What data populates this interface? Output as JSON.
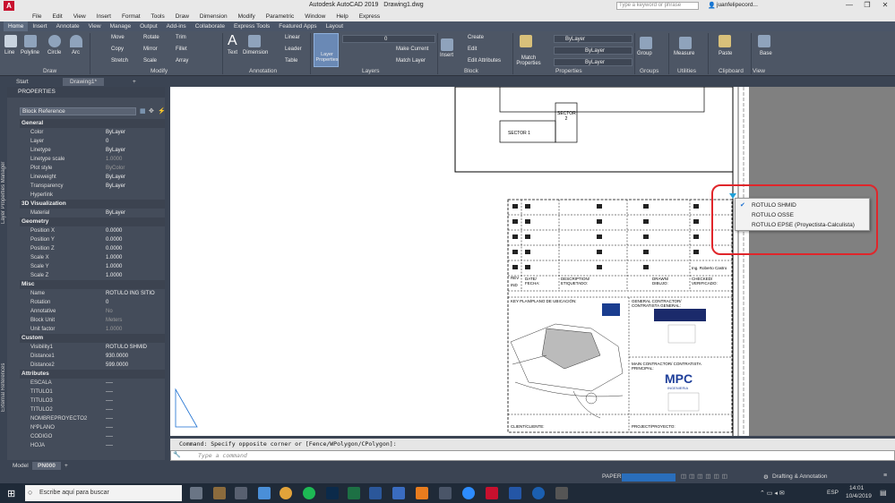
{
  "titlebar": {
    "app": "Autodesk AutoCAD 2019",
    "file": "Drawing1.dwg",
    "search_placeholder": "Type a keyword or phrase",
    "user": "juanfelipecord..."
  },
  "menubar": [
    "File",
    "Edit",
    "View",
    "Insert",
    "Format",
    "Tools",
    "Draw",
    "Dimension",
    "Modify",
    "Parametric",
    "Window",
    "Help",
    "Express"
  ],
  "ribbon_tabs": [
    "Home",
    "Insert",
    "Annotate",
    "View",
    "Manage",
    "Output",
    "Add-ins",
    "Collaborate",
    "Express Tools",
    "Featured Apps",
    "Layout"
  ],
  "ribbon": {
    "draw": [
      "Line",
      "Polyline",
      "Circle",
      "Arc"
    ],
    "modify": [
      "Move",
      "Rotate",
      "Trim",
      "Copy",
      "Mirror",
      "Fillet",
      "Stretch",
      "Scale",
      "Array"
    ],
    "annotation": [
      "Text",
      "Dimension",
      "Linear",
      "Leader",
      "Table"
    ],
    "layers": {
      "btn": "Layer Properties",
      "current": "0",
      "make_current": "Make Current",
      "match_layer": "Match Layer"
    },
    "block": [
      "Insert",
      "Create",
      "Edit",
      "Edit Attributes"
    ],
    "properties": {
      "match": "Match Properties",
      "bylayer1": "ByLayer",
      "bylayer2": "ByLayer",
      "bylayer3": "ByLayer"
    },
    "groups": "Group",
    "utilities": "Measure",
    "clipboard": "Paste",
    "base": "Base",
    "group_labels": [
      "Draw",
      "Modify",
      "Annotation",
      "Layers",
      "Block",
      "Properties",
      "Groups",
      "Utilities",
      "Clipboard",
      "View"
    ]
  },
  "file_tabs": [
    "Start",
    "Drawing1*"
  ],
  "palette": {
    "title": "PROPERTIES",
    "selector": "Block Reference",
    "side_left": "Layer Properties Manager",
    "side_left2": "External References",
    "sections": [
      {
        "name": "General",
        "props": [
          [
            "Color",
            "ByLayer"
          ],
          [
            "Layer",
            "0"
          ],
          [
            "Linetype",
            "ByLayer"
          ],
          [
            "Linetype scale",
            "1.0000"
          ],
          [
            "Plot style",
            "ByColor"
          ],
          [
            "Lineweight",
            "ByLayer"
          ],
          [
            "Transparency",
            "ByLayer"
          ],
          [
            "Hyperlink",
            ""
          ]
        ]
      },
      {
        "name": "3D Visualization",
        "props": [
          [
            "Material",
            "ByLayer"
          ]
        ]
      },
      {
        "name": "Geometry",
        "props": [
          [
            "Position X",
            "0.0000"
          ],
          [
            "Position Y",
            "0.0000"
          ],
          [
            "Position Z",
            "0.0000"
          ],
          [
            "Scale X",
            "1.0000"
          ],
          [
            "Scale Y",
            "1.0000"
          ],
          [
            "Scale Z",
            "1.0000"
          ]
        ]
      },
      {
        "name": "Misc",
        "props": [
          [
            "Name",
            "ROTULO ING SITIO"
          ],
          [
            "Rotation",
            "0"
          ],
          [
            "Annotative",
            "No"
          ],
          [
            "Block Unit",
            "Meters"
          ],
          [
            "Unit factor",
            "1.0000"
          ]
        ]
      },
      {
        "name": "Custom",
        "props": [
          [
            "Visibility1",
            "ROTULO SHMID"
          ],
          [
            "Distance1",
            "930.0000"
          ],
          [
            "Distance2",
            "599.0000"
          ]
        ]
      },
      {
        "name": "Attributes",
        "props": [
          [
            "ESCALA",
            "----"
          ],
          [
            "TITULO1",
            "----"
          ],
          [
            "TITULO3",
            "----"
          ],
          [
            "TITULO2",
            "----"
          ],
          [
            "NOMBREPROYECTO2",
            "----"
          ],
          [
            "NºPLANO",
            "----"
          ],
          [
            "CODIGO",
            "----"
          ],
          [
            "HOJA",
            "----"
          ]
        ]
      }
    ]
  },
  "drawing": {
    "sector1": "SECTOR 1",
    "sector2": "SECTOR 2",
    "engineer": "Ing. Roberto Castro",
    "rev": "REV",
    "ind": "IND",
    "date": "DATE/ FECHA:",
    "desc": "DESCRIPTION/ ETIQUETADO:",
    "drawn": "DRAWN/ DIBUJO:",
    "checked": "CHECKED/ VERIFICADO:",
    "keyplan": "KEY PLAN/PLANO DE UBICACIÓN:",
    "gen_contractor": "GENERAL CONTRACTOR/ CONTRATISTA GENERAL:",
    "main_contractor": "MAIN CONTRACTOR/ CONTRATISTA PRINCIPAL:",
    "mpc": "MPC",
    "mpc_sub": "INGENIERIA",
    "client": "CLIENT/CLIENTE:",
    "project": "PROJECT/PROYECTO:"
  },
  "dropdown": {
    "items": [
      "ROTULO SHMID",
      "ROTULO OSSE",
      "ROTULO EPSE (Proyectista-Calculista)"
    ],
    "checked_index": 0
  },
  "command": {
    "history": "Command: Specify opposite corner or [Fence/WPolygon/CPolygon]:",
    "placeholder": "Type a command"
  },
  "layout_tabs": [
    "Model",
    "PN000"
  ],
  "status": {
    "space": "PAPER",
    "workspace": "Drafting & Annotation"
  },
  "taskbar": {
    "search": "Escribe aquí para buscar",
    "lang": "ESP",
    "time": "14:01",
    "date": "10/4/2019"
  },
  "colors": {
    "highlight": "#e0262b",
    "ribbon": "#4d5665",
    "accent_blue": "#2a6ebb"
  }
}
